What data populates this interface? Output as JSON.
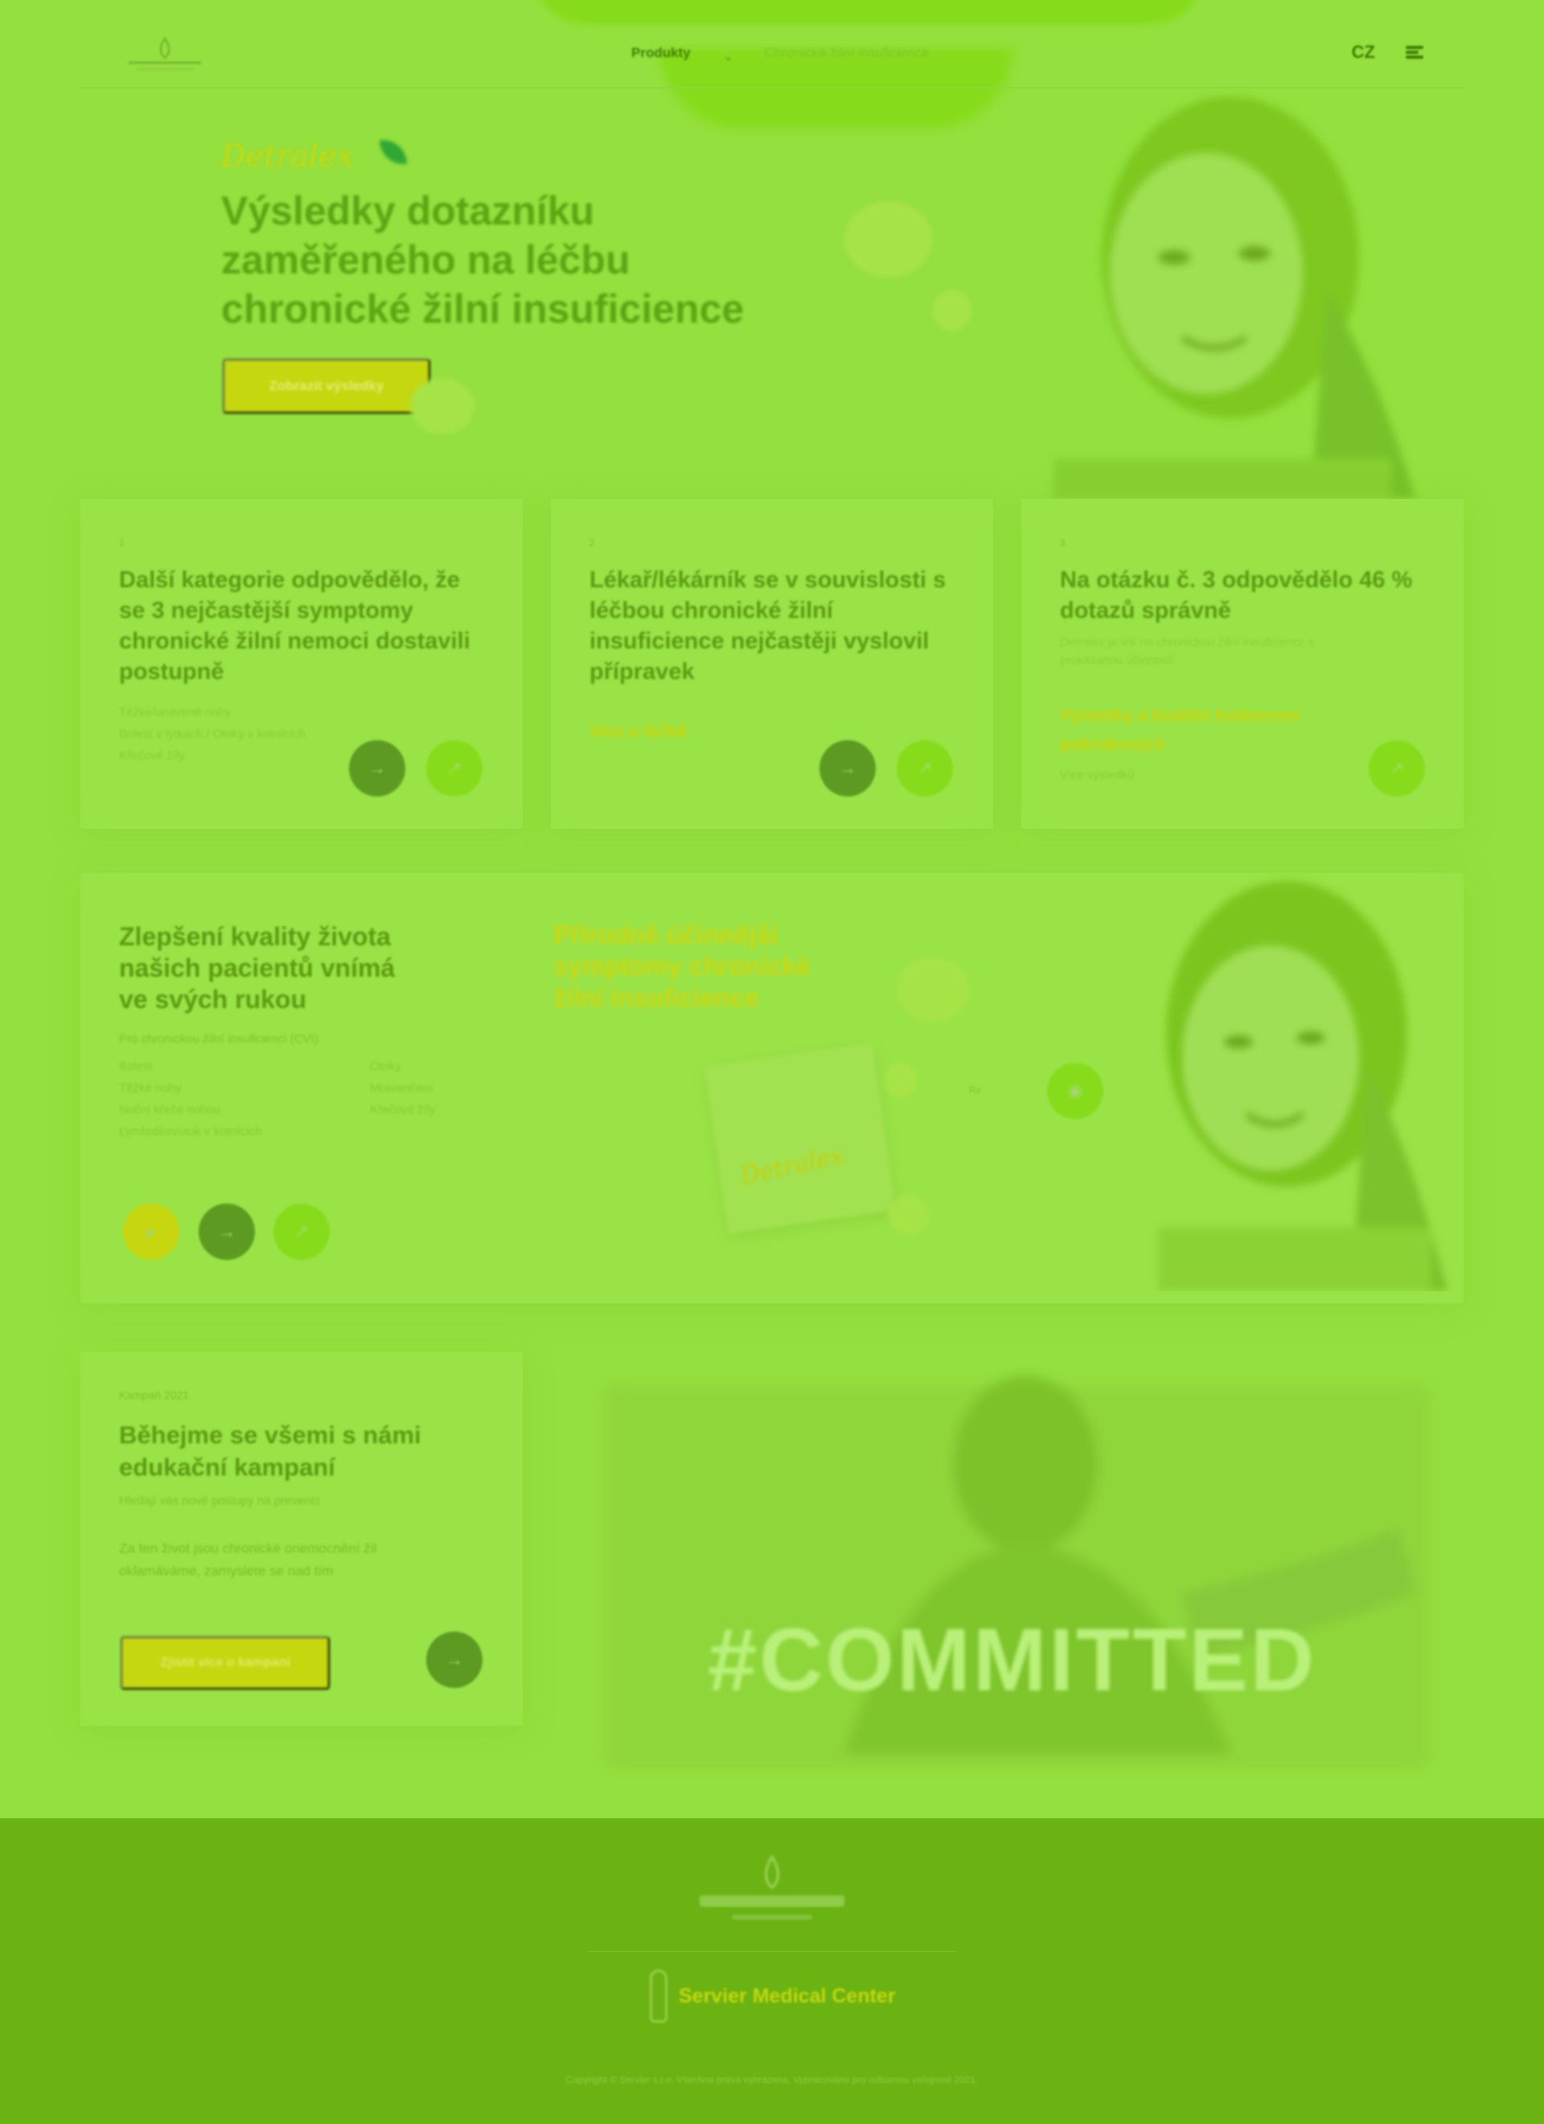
{
  "header": {
    "nav": [
      {
        "label": "Produkty",
        "active": true
      },
      {
        "label": "Chronická žilní insuficience",
        "active": false
      }
    ],
    "lang": "CZ"
  },
  "hero": {
    "brand": "Detralex",
    "title": "Výsledky dotazníku zaměřeného na léčbu chronické žilní insuficience",
    "button": "Zobrazit výsledky"
  },
  "cards": [
    {
      "num": "1",
      "title": "Další kategorie odpovědělo, že se 3 nejčastější symptomy chronické žilní nemoci dostavili postupně",
      "list": [
        "Těžké/unavené nohy",
        "Bolest v lýtkách / Otoky v kotnících",
        "Křečové žíly"
      ]
    },
    {
      "num": "2",
      "title": "Lékař/lékárník se v souvislosti s léčbou chronické žilní insuficience nejčastěji vyslovil přípravek",
      "link": "Více o léčbě"
    },
    {
      "num": "3",
      "title": "Na otázku č. 3 odpovědělo 46 % dotazů správně",
      "desc": "Detralex je lék na chronickou žilní insuficienci, s prokázanou účinností",
      "link": "Výsledky a kvalitní hodnocení pokrokových",
      "list": [
        "Více výsledků"
      ]
    }
  ],
  "promo": {
    "title": "Zlepšení kvality života našich pacientů vnímá ve svých rukou",
    "sub": "Pro chronickou žilní insuficienci (CVI):",
    "list_left": [
      "Bolest",
      "Těžké nohy",
      "Noční křeče nohou",
      "Lymfedém/otok v kotnících"
    ],
    "list_right": [
      "Otoky",
      "Mravenčení",
      "Křečové žíly"
    ],
    "highlight": "Přírodně účinnější symptomy chronické žilní insuficience",
    "brand": "Detralex",
    "side_badge": "Rx"
  },
  "campaign": {
    "small": "Kampaň 2021",
    "title": "Běhejme se všemi s námi edukační kampaní",
    "sub": "Hledají vás nové postupy na prevenci",
    "text": "Za ten život jsou chronické onemocnění žil oklamáváme, zamyslete se nad tím",
    "button": "Zjistit více o kampani",
    "committed": "#COMMITTED"
  },
  "footer": {
    "partner": "Servier Medical Center",
    "copyright": "Copyright © Servier s.r.o. Všechna práva vyhrazena. Vypracováno pro odbornou veřejnost 2021."
  },
  "colors": {
    "background": "#94e03e",
    "accent_yellow": "#c6d60f",
    "dark_green": "#5c9a22",
    "bright_green": "#86dc1a",
    "footer": "#6bb312"
  }
}
